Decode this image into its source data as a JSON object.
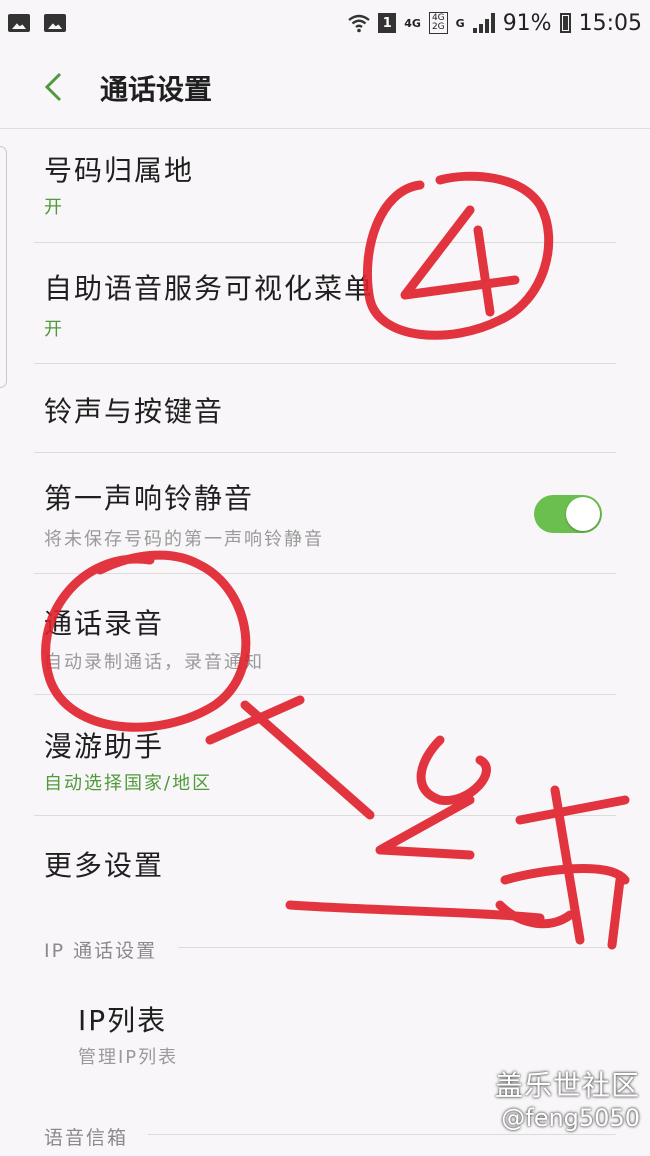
{
  "status_bar": {
    "sim": "1",
    "net_4g": "4G",
    "net_box": [
      "4G",
      "2G"
    ],
    "net_g": "G",
    "battery": "91%",
    "time": "15:05"
  },
  "header": {
    "title": "通话设置"
  },
  "settings": [
    {
      "title": "号码归属地",
      "subtitle": "开"
    },
    {
      "title": "自助语音服务可视化菜单",
      "subtitle": "开"
    },
    {
      "title": "铃声与按键音"
    },
    {
      "title": "第一声响铃静音",
      "subtitle": "将未保存号码的第一声响铃静音",
      "toggle_on": true
    },
    {
      "title": "通话录音",
      "subtitle": "自动录制通话，录音通知"
    },
    {
      "title": "漫游助手",
      "subtitle": "自动选择国家/地区"
    },
    {
      "title": "更多设置"
    }
  ],
  "ip_section": {
    "header": "IP 通话设置",
    "item": {
      "title": "IP列表",
      "subtitle": "管理IP列表"
    }
  },
  "voicemail_section": {
    "header": "语音信箱"
  },
  "watermark": {
    "line1": "盖乐世社区",
    "line2": "@feng5050"
  },
  "colors": {
    "accent": "#4f9a3a",
    "toggle": "#6bbf4e",
    "annotation": "#e0202a"
  }
}
